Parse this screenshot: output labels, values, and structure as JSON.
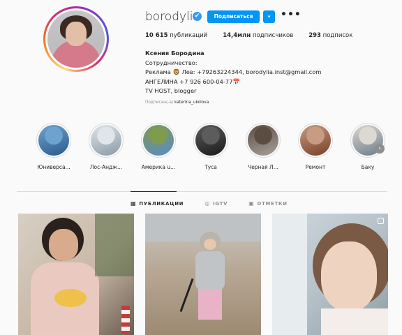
{
  "profile": {
    "username": "borodylia",
    "verified_glyph": "✔",
    "follow_label": "Подписаться",
    "dropdown_glyph": "▾",
    "more_glyph": "•••",
    "stats": {
      "posts_count": "10 615",
      "posts_label": "публикаций",
      "followers_count": "14,4млн",
      "followers_label": "подписчиков",
      "following_count": "293",
      "following_label": "подписок"
    },
    "bio": {
      "name": "Ксения Бородина",
      "line1": "Сотрудничество:",
      "line2": "Реклама 🦁 Лев: +79263224344, borodylia.inst@gmail.com",
      "line3": "АНГЕЛИНА +7 926 600-04-77📅",
      "line4": "TV HOST, blogger"
    },
    "followed_by_prefix": "Подписан(-а) ",
    "followed_by_user": "katerina_ukolova"
  },
  "highlights": [
    {
      "label": "Юниверса...",
      "colors": [
        "#2a5a8a",
        "#6fa3cf"
      ]
    },
    {
      "label": "Лос-Андж...",
      "colors": [
        "#8a9aa6",
        "#dfe6ea"
      ]
    },
    {
      "label": "Америка u...",
      "colors": [
        "#5b8bc7",
        "#7e9b4e"
      ]
    },
    {
      "label": "Туса",
      "colors": [
        "#1a1a1a",
        "#5c5c5c"
      ]
    },
    {
      "label": "Черная Л...",
      "colors": [
        "#a7a19b",
        "#5b4d41"
      ]
    },
    {
      "label": "Ремонт",
      "colors": [
        "#7a3f28",
        "#c79c82"
      ]
    },
    {
      "label": "Баку",
      "colors": [
        "#6d7c8a",
        "#dcd8d2"
      ]
    }
  ],
  "next_glyph": "›",
  "tabs": [
    {
      "label": "ПУБЛИКАЦИИ",
      "icon": "grid-icon",
      "glyph": "▦"
    },
    {
      "label": "IGTV",
      "icon": "igtv-icon",
      "glyph": "◎"
    },
    {
      "label": "ОТМЕТКИ",
      "icon": "tagged-icon",
      "glyph": "▣"
    }
  ]
}
